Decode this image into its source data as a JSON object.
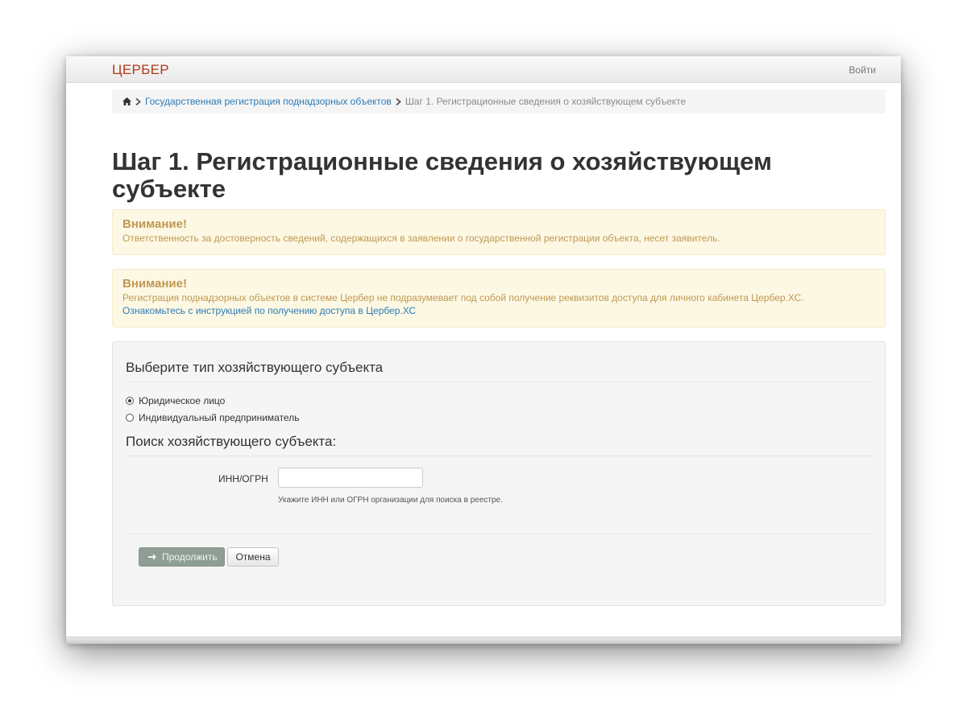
{
  "navbar": {
    "brand": "ЦЕРБЕР",
    "login_label": "Войти"
  },
  "breadcrumb": {
    "home_icon": "home-icon",
    "items": [
      {
        "label": "Государственная регистрация поднадзорных объектов",
        "link": true
      },
      {
        "label": "Шаг 1. Регистрационные сведения о хозяйствующем субъекте",
        "link": false
      }
    ]
  },
  "page": {
    "title": "Шаг 1. Регистрационные сведения о хозяйствующем субъекте"
  },
  "alerts": [
    {
      "title": "Внимание!",
      "text": "Ответственность за достоверность сведений, содержащихся в заявлении о государственной регистрации объекта, несет заявитель."
    },
    {
      "title": "Внимание!",
      "text": "Регистрация поднадзорных объектов в системе Цербер не подразумевает под собой получение реквизитов доступа для личного кабинета Цербер.ХС.",
      "link_text": "Ознакомьтесь с инструкцией по получению доступа в Цербер.ХС"
    }
  ],
  "form": {
    "subject_type_legend": "Выберите тип хозяйствующего субъекта",
    "radio_options": [
      {
        "label": "Юридическое лицо",
        "checked": true
      },
      {
        "label": "Индивидуальный предприниматель",
        "checked": false
      }
    ],
    "search_legend": "Поиск хозяйствующего субъекта:",
    "inn_label": "ИНН/ОГРН",
    "inn_value": "",
    "inn_help": "Укажите ИНН или ОГРН организации для поиска в реестре.",
    "continue_label": "Продолжить",
    "cancel_label": "Отмена"
  },
  "colors": {
    "brand": "#b0391b",
    "link": "#2c7bb6",
    "alert_bg": "#fcf8e3",
    "alert_text": "#c09853",
    "continue_button": "#8f9e94"
  }
}
